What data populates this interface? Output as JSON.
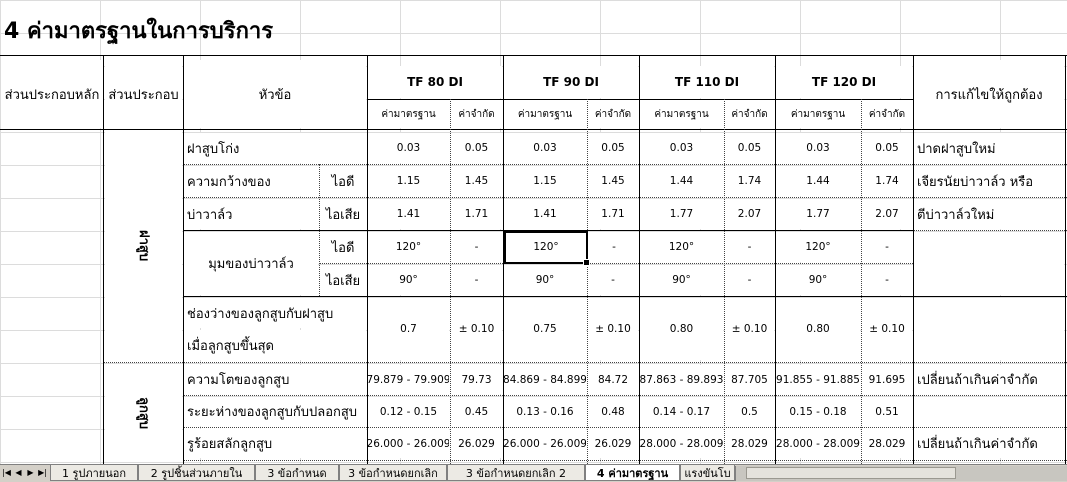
{
  "sheet": {
    "title": "4 ค่ามาตรฐานในการบริการ",
    "headers": {
      "main_component": "ส่วนประกอบหลัก",
      "component": "ส่วนประกอบ",
      "topic": "หัวข้อ",
      "correction": "การแก้ไขให้ถูกต้อง"
    },
    "models": [
      "TF 80 DI",
      "TF 90 DI",
      "TF 110 DI",
      "TF 120 DI"
    ],
    "sub_headers": {
      "standard": "ค่ามาตรฐาน",
      "limit": "ค่าจำกัด"
    },
    "groups": [
      {
        "label": "ฝาสูบ"
      },
      {
        "label": "ลูกสูบ"
      }
    ],
    "rows": {
      "r1": {
        "topic": "ฝาสูบโก่ง",
        "sub": "",
        "values": [
          "0.03",
          "0.05",
          "0.03",
          "0.05",
          "0.03",
          "0.05",
          "0.03",
          "0.05"
        ],
        "fix": "ปาดฝาสูบใหม่"
      },
      "r2": {
        "topic": "ความกว้างของ",
        "sub": "ไอดี",
        "values": [
          "1.15",
          "1.45",
          "1.15",
          "1.45",
          "1.44",
          "1.74",
          "1.44",
          "1.74"
        ],
        "fix": "เจียรนัยบ่าวาล์ว หรือ"
      },
      "r3": {
        "topic": "บ่าวาล์ว",
        "sub": "ไอเสีย",
        "values": [
          "1.41",
          "1.71",
          "1.41",
          "1.71",
          "1.77",
          "2.07",
          "1.77",
          "2.07"
        ],
        "fix": "ตีบ่าวาล์วใหม่"
      },
      "r4": {
        "topic": "มุมของบ่าวาล์ว",
        "sub": "ไอดี",
        "values": [
          "120°",
          "-",
          "120°",
          "-",
          "120°",
          "-",
          "120°",
          "-"
        ],
        "fix": ""
      },
      "r5": {
        "topic": "",
        "sub": "ไอเสีย",
        "values": [
          "90°",
          "-",
          "90°",
          "-",
          "90°",
          "-",
          "90°",
          "-"
        ],
        "fix": ""
      },
      "r6": {
        "topic": "ช่องว่างของลูกสูบกับฝาสูบ",
        "topic2": "เมื่อลูกสูบขึ้นสุด",
        "values": [
          "0.7",
          "± 0.10",
          "0.75",
          "± 0.10",
          "0.80",
          "± 0.10",
          "0.80",
          "± 0.10"
        ],
        "fix": ""
      },
      "r7": {
        "topic": "ความโตของลูกสูบ",
        "values": [
          "79.879 - 79.909",
          "79.73",
          "84.869 - 84.899",
          "84.72",
          "87.863 - 89.893",
          "87.705",
          "91.855 - 91.885",
          "91.695"
        ],
        "fix": "เปลี่ยนถ้าเกินค่าจำกัด"
      },
      "r8": {
        "topic": "ระยะห่างของลูกสูบกับปลอกสูบ",
        "values": [
          "0.12 - 0.15",
          "0.45",
          "0.13 - 0.16",
          "0.48",
          "0.14 - 0.17",
          "0.5",
          "0.15 - 0.18",
          "0.51"
        ],
        "fix": ""
      },
      "r9": {
        "topic": "รูร้อยสลักลูกสูบ",
        "values": [
          "26.000 - 26.009",
          "26.029",
          "26.000 - 26.009",
          "26.029",
          "28.000 - 28.009",
          "28.029",
          "28.000 - 28.009",
          "28.029"
        ],
        "fix": "เปลี่ยนถ้าเกินค่าจำกัด"
      }
    }
  },
  "tabs": [
    "1 รูปภายนอก",
    "2 รูปชิ้นส่วนภายใน",
    "3 ข้อกำหนด",
    "3 ข้อกำหนดยกเลิก",
    "3 ข้อกำหนดยกเลิก 2",
    "4 ค่ามาตรฐาน",
    "แรงขันโบ"
  ],
  "active_tab": "4 ค่ามาตรฐาน"
}
